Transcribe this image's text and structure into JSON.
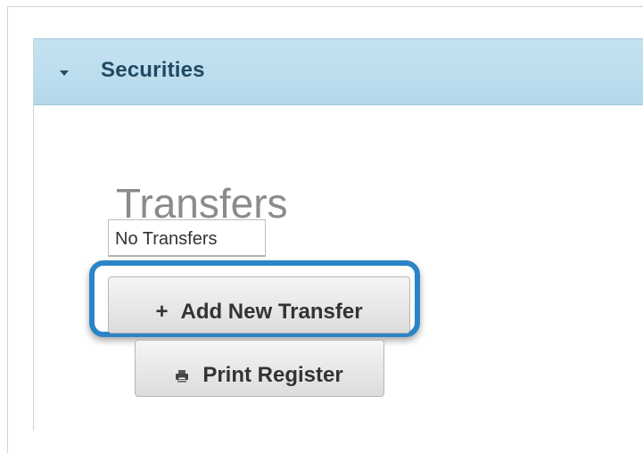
{
  "panel": {
    "title": "Securities",
    "collapse_icon": "caret-down-icon",
    "colors": {
      "header_background": "#b5d9ea",
      "header_text": "#1f4a63",
      "highlight": "#2b84c6"
    }
  },
  "transfers": {
    "heading": "Transfers",
    "empty_message": "No Transfers",
    "add_button_icon": "+",
    "add_button_label": "Add New Transfer",
    "print_button_icon": "printer-icon",
    "print_button_label": "Print Register"
  }
}
